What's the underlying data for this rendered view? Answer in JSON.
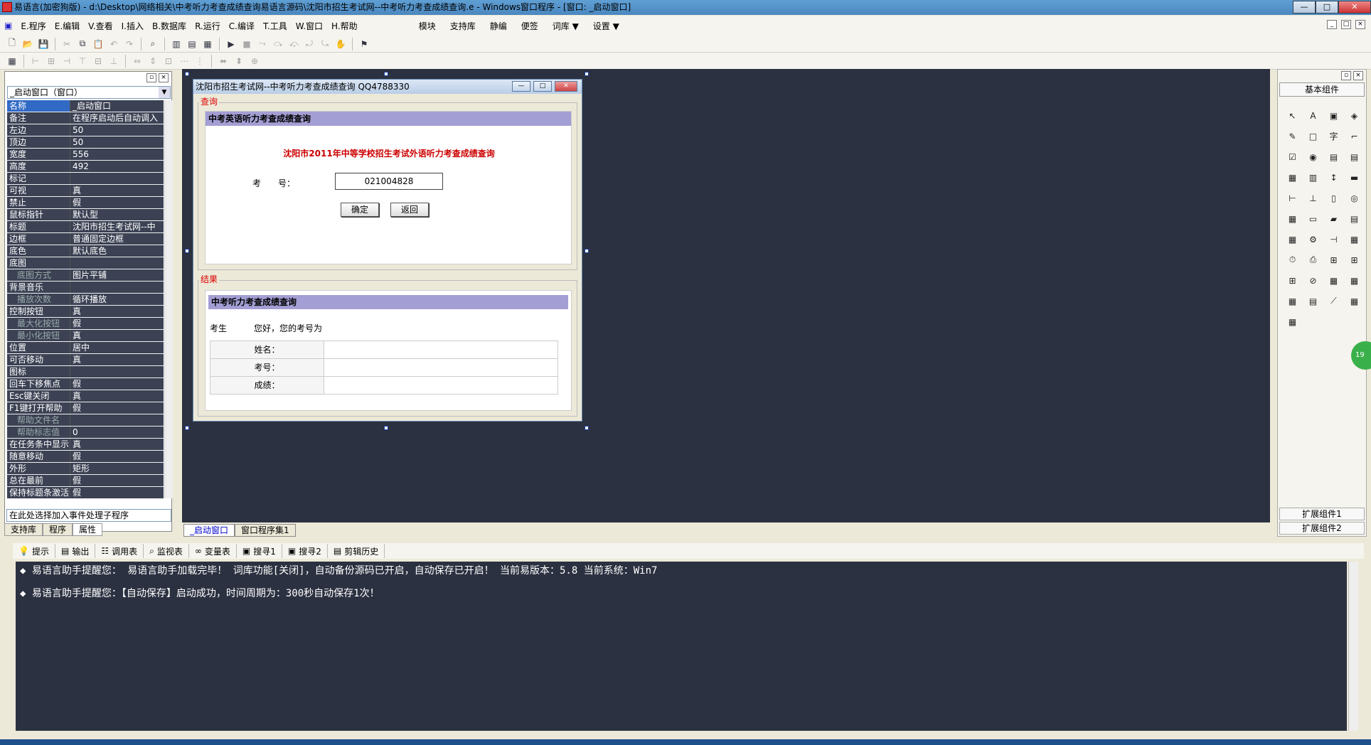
{
  "window": {
    "title": "易语言(加密狗版) - d:\\Desktop\\网络相关\\中考听力考查成绩查询易语言源码\\沈阳市招生考试网--中考听力考查成绩查询.e - Windows窗口程序 - [窗口: _启动窗口]",
    "min": "—",
    "max": "□",
    "close": "✕"
  },
  "menu": {
    "items": [
      "E.程序",
      "E.编辑",
      "V.查看",
      "I.插入",
      "B.数据库",
      "R.运行",
      "C.编译",
      "T.工具",
      "W.窗口",
      "H.帮助"
    ],
    "extra": [
      "模块",
      "支持库",
      "静编",
      "便签",
      "词库 ▼",
      "设置 ▼"
    ]
  },
  "object_combo": "_启动窗口（窗口）",
  "properties": [
    {
      "name": "名称",
      "value": "_启动窗口"
    },
    {
      "name": "备注",
      "value": "在程序启动后自动调入"
    },
    {
      "name": "左边",
      "value": "50"
    },
    {
      "name": "顶边",
      "value": "50"
    },
    {
      "name": "宽度",
      "value": "556"
    },
    {
      "name": "高度",
      "value": "492"
    },
    {
      "name": "标记",
      "value": ""
    },
    {
      "name": "可视",
      "value": "真"
    },
    {
      "name": "禁止",
      "value": "假"
    },
    {
      "name": "鼠标指针",
      "value": "默认型"
    },
    {
      "name": "标题",
      "value": "沈阳市招生考试网--中"
    },
    {
      "name": "边框",
      "value": "普通固定边框"
    },
    {
      "name": "底色",
      "value": "默认底色"
    },
    {
      "name": "底图",
      "value": ""
    },
    {
      "name": "底图方式",
      "value": "图片平铺"
    },
    {
      "name": "背景音乐",
      "value": ""
    },
    {
      "name": "播放次数",
      "value": "循环播放"
    },
    {
      "name": "控制按钮",
      "value": "真"
    },
    {
      "name": "最大化按钮",
      "value": "假"
    },
    {
      "name": "最小化按钮",
      "value": "真"
    },
    {
      "name": "位置",
      "value": "居中"
    },
    {
      "name": "可否移动",
      "value": "真"
    },
    {
      "name": "图标",
      "value": ""
    },
    {
      "name": "回车下移焦点",
      "value": "假"
    },
    {
      "name": "Esc键关闭",
      "value": "真"
    },
    {
      "name": "F1键打开帮助",
      "value": "假"
    },
    {
      "name": "帮助文件名",
      "value": ""
    },
    {
      "name": "帮助标志值",
      "value": "0"
    },
    {
      "name": "在任务条中显示",
      "value": "真"
    },
    {
      "name": "随意移动",
      "value": "假"
    },
    {
      "name": "外形",
      "value": "矩形"
    },
    {
      "name": "总在最前",
      "value": "假"
    },
    {
      "name": "保持标题条激活",
      "value": "假"
    }
  ],
  "event_combo": "在此处选择加入事件处理子程序",
  "left_tabs": [
    "支持库",
    "程序",
    "属性"
  ],
  "form": {
    "title": "沈阳市招生考试网--中考听力考查成绩查询 QQ4788330",
    "query_group": "查询",
    "query_header": "中考英语听力考查成绩查询",
    "query_title": "沈阳市2011年中等学校招生考试外语听力考查成绩查询",
    "exam_label": "考　　号：",
    "exam_value": "021004828",
    "ok_button": "确定",
    "back_button": "返回",
    "result_group": "结果",
    "result_header": "中考听力考查成绩查询",
    "student_label": "考生",
    "greeting": "您好，您的考号为",
    "rows": [
      "姓名：",
      "考号：",
      "成绩："
    ]
  },
  "right_panel": {
    "header": "基本组件",
    "icons": [
      "↖",
      "A",
      "▣",
      "◈",
      "✎",
      "□",
      "字",
      "⌐",
      "☑",
      "◉",
      "▤",
      "▤",
      "▦",
      "▥",
      "↕",
      "▬",
      "⊢",
      "⊥",
      "▯",
      "◎",
      "▦",
      "▭",
      "▰",
      "▤",
      "▦",
      "⚙",
      "⊣",
      "▦",
      "⏱",
      "⎙",
      "⊞",
      "⊞",
      "⊞",
      "⊘",
      "▦",
      "▦",
      "▦",
      "▤",
      "⟋",
      "▦",
      "▦"
    ],
    "footer1": "扩展组件1",
    "footer2": "扩展组件2"
  },
  "doc_tabs": [
    "_启动窗口",
    "窗口程序集1"
  ],
  "output_tabs": [
    "提示",
    "输出",
    "调用表",
    "监视表",
    "变量表",
    "搜寻1",
    "搜寻2",
    "剪辑历史"
  ],
  "output_lines": [
    "◆ 易语言助手提醒您： 易语言助手加载完毕！ 词库功能[关闭]，自动备份源码已开启，自动保存已开启！ 当前易版本：5.8  当前系统：Win7",
    "◆ 易语言助手提醒您：【自动保存】启动成功，时间周期为：300秒自动保存1次！"
  ],
  "greenball": "19"
}
